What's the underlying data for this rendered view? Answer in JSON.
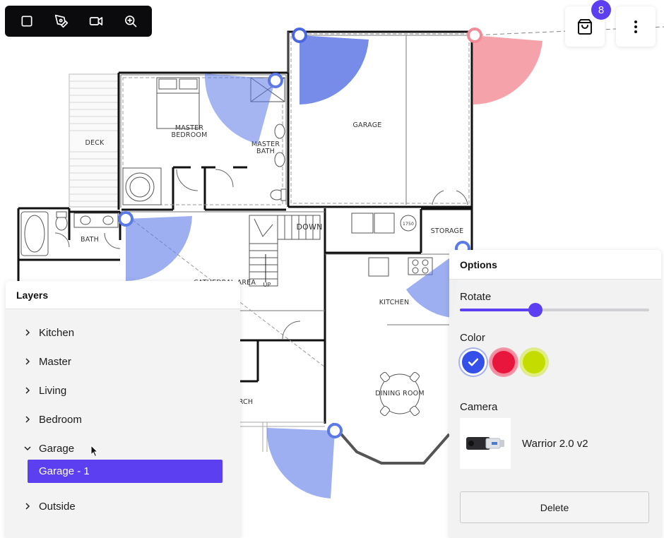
{
  "toolbar": {
    "tools": [
      {
        "name": "select-rectangle-tool",
        "icon": "square-icon"
      },
      {
        "name": "pen-tool",
        "icon": "pen-icon"
      },
      {
        "name": "camera-tool",
        "icon": "video-camera-icon"
      },
      {
        "name": "zoom-tool",
        "icon": "zoom-in-icon"
      }
    ]
  },
  "header": {
    "cart_count": "8",
    "cart_icon": "shopping-bag-icon",
    "more_icon": "more-vertical-icon"
  },
  "floorplan": {
    "rooms": [
      "DECK",
      "MASTER",
      "BEDROOM",
      "MASTER",
      "BATH",
      "GARAGE",
      "BATH",
      "DOWN",
      "STORAGE",
      "UP",
      "CATHEDRAL AREA",
      "KITCHEN",
      "DINING ROOM",
      "RCH"
    ],
    "appliance_label": "1750",
    "camera_colors": {
      "blue": "#5b79e8",
      "red": "#f28b96"
    }
  },
  "layers": {
    "title": "Layers",
    "items": [
      {
        "label": "Kitchen",
        "expanded": false
      },
      {
        "label": "Master",
        "expanded": false
      },
      {
        "label": "Living",
        "expanded": false
      },
      {
        "label": "Bedroom",
        "expanded": false
      },
      {
        "label": "Garage",
        "expanded": true,
        "children": [
          {
            "label": "Garage - 1",
            "selected": true
          }
        ]
      },
      {
        "label": "Outside",
        "expanded": false
      }
    ]
  },
  "options": {
    "title": "Options",
    "rotate_label": "Rotate",
    "rotate_value": 0.4,
    "color_label": "Color",
    "colors": [
      {
        "name": "blue",
        "hex": "#3550e8",
        "selected": true
      },
      {
        "name": "red",
        "hex": "#e8153c",
        "selected": false
      },
      {
        "name": "lime",
        "hex": "#c4dc00",
        "selected": false
      }
    ],
    "camera_label": "Camera",
    "camera_name": "Warrior 2.0 v2",
    "delete_label": "Delete"
  },
  "colors": {
    "accent": "#5b3ff0",
    "toolbar_bg": "#0b0b0d"
  }
}
